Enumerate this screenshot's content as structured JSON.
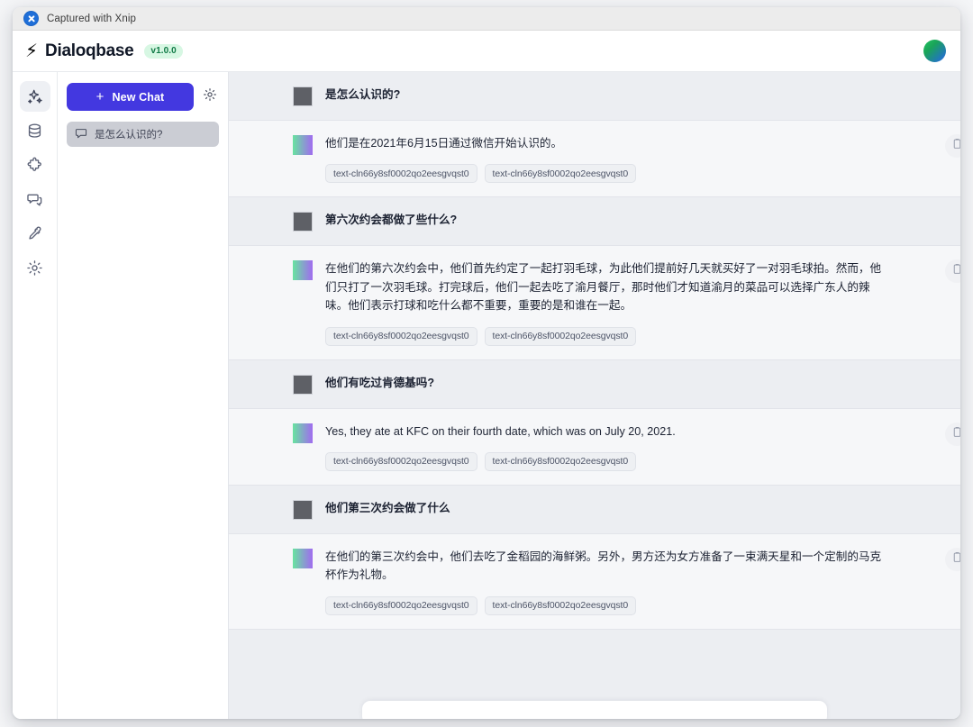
{
  "capture_bar": {
    "label": "Captured with Xnip",
    "logo_icon": "xnip-logo-icon"
  },
  "header": {
    "bolt_icon": "⚡",
    "brand": "Dialoqbase",
    "version": "v1.0.0",
    "avatar_icon": "user-avatar"
  },
  "icon_rail": {
    "items": [
      {
        "name": "sparkles",
        "active": true
      },
      {
        "name": "database",
        "active": false
      },
      {
        "name": "puzzle",
        "active": false
      },
      {
        "name": "chat-bubbles",
        "active": false
      },
      {
        "name": "eyedropper",
        "active": false
      },
      {
        "name": "gear",
        "active": false
      }
    ]
  },
  "sidebar": {
    "new_chat_label": "New Chat",
    "plus_icon": "+",
    "settings_icon": "gear-icon",
    "chats": [
      {
        "label": "是怎么认识的?",
        "icon": "chat-bubble-icon",
        "active": true
      }
    ]
  },
  "conversation": {
    "tag_label_a": "text-cln66y8sf0002qo2eesgvqst0",
    "tag_label_b": "text-cln66y8sf0002qo2eesgvqst0",
    "copy_icon": "clipboard-icon",
    "messages": [
      {
        "role": "user",
        "text": "是怎么认识的?"
      },
      {
        "role": "assistant",
        "text": "他们是在2021年6月15日通过微信开始认识的。",
        "tags": [
          "text-cln66y8sf0002qo2eesgvqst0",
          "text-cln66y8sf0002qo2eesgvqst0"
        ]
      },
      {
        "role": "user",
        "text": "第六次约会都做了些什么?"
      },
      {
        "role": "assistant",
        "text": "在他们的第六次约会中，他们首先约定了一起打羽毛球，为此他们提前好几天就买好了一对羽毛球拍。然而，他们只打了一次羽毛球。打完球后，他们一起去吃了渝月餐厅，那时他们才知道渝月的菜品可以选择广东人的辣味。他们表示打球和吃什么都不重要，重要的是和谁在一起。",
        "tags": [
          "text-cln66y8sf0002qo2eesgvqst0",
          "text-cln66y8sf0002qo2eesgvqst0"
        ]
      },
      {
        "role": "user",
        "text": "他们有吃过肯德基吗?"
      },
      {
        "role": "assistant",
        "text": "Yes, they ate at KFC on their fourth date, which was on July 20, 2021.",
        "tags": [
          "text-cln66y8sf0002qo2eesgvqst0",
          "text-cln66y8sf0002qo2eesgvqst0"
        ]
      },
      {
        "role": "user",
        "text": "他们第三次约会做了什么"
      },
      {
        "role": "assistant",
        "text": "在他们的第三次约会中，他们去吃了金稻园的海鲜粥。另外，男方还为女方准备了一束满天星和一个定制的马克杯作为礼物。",
        "tags": [
          "text-cln66y8sf0002qo2eesgvqst0",
          "text-cln66y8sf0002qo2eesgvqst0"
        ]
      }
    ],
    "composer_placeholder": ""
  },
  "colors": {
    "accent": "#4338e0",
    "badge_bg": "#d7f7e3",
    "badge_text": "#107a46",
    "user_row_bg": "#eceef2",
    "assistant_row_bg": "#f6f7f9"
  }
}
